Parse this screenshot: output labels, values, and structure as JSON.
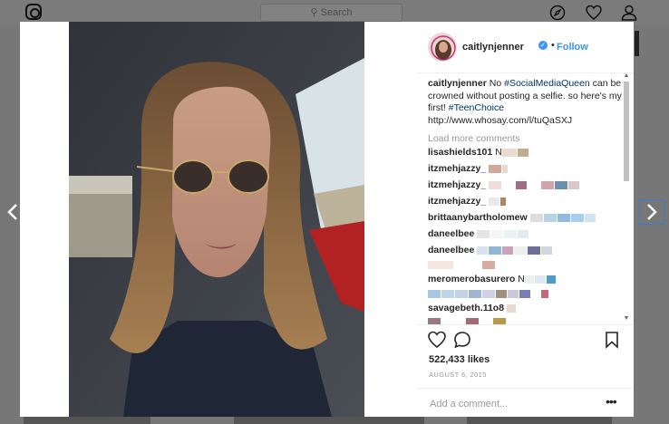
{
  "background": {
    "search_placeholder": "Search",
    "icons": [
      "instagram-logo-icon",
      "compass-icon",
      "heart-icon",
      "person-icon"
    ]
  },
  "post": {
    "username": "caitlynjenner",
    "follow_label": "Follow",
    "separator": "•",
    "caption": {
      "username": "caitlynjenner",
      "text_1": "No ",
      "tag_1": "#SocialMediaQueen",
      "text_2": " can be crowned without posting a selfie. so here's my first! ",
      "tag_2": "#TeenChoice",
      "link": "http://www.whosay.com/l/tuQaSXJ"
    },
    "load_more": "Load more comments",
    "comments": [
      {
        "username": "lisashields101",
        "suffix": "N"
      },
      {
        "username": "itzmehjazzy_",
        "suffix": ""
      },
      {
        "username": "itzmehjazzy_",
        "suffix": ""
      },
      {
        "username": "itzmehjazzy_",
        "suffix": ""
      },
      {
        "username": "brittaanybartholomew",
        "suffix": ""
      },
      {
        "username": "daneelbee",
        "suffix": ""
      },
      {
        "username": "daneelbee",
        "suffix": ""
      },
      {
        "username": "meromerobasurero",
        "suffix": "N"
      },
      {
        "username": "savagebeth.11o8",
        "suffix": ""
      }
    ],
    "likes": "522,433 likes",
    "date": "AUGUST 6, 2015",
    "comment_placeholder": "Add a comment...",
    "more_label": "•••"
  },
  "colors": {
    "link_blue": "#3897f0",
    "hashtag": "#003569",
    "overlay": "#777777"
  }
}
